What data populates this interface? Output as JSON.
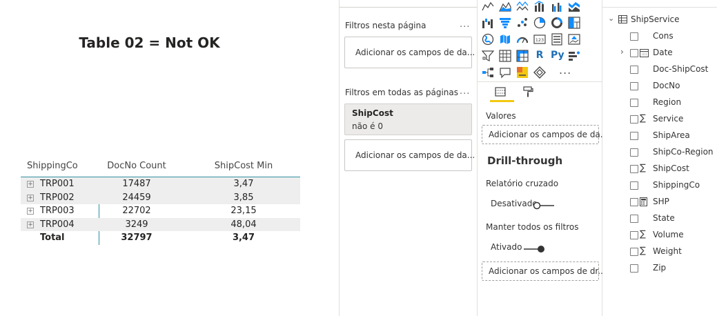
{
  "report": {
    "title": "Table 02 = Not OK",
    "matrix": {
      "headers": [
        "ShippingCo",
        "DocNo Count",
        "ShipCost Min"
      ],
      "rows": [
        {
          "co": "TRP001",
          "count": "17487",
          "min": "3,47"
        },
        {
          "co": "TRP002",
          "count": "24459",
          "min": "3,85"
        },
        {
          "co": "TRP003",
          "count": "22702",
          "min": "23,15"
        },
        {
          "co": "TRP004",
          "count": "3249",
          "min": "48,04"
        }
      ],
      "total": {
        "label": "Total",
        "count": "32797",
        "min": "3,47"
      }
    }
  },
  "filters": {
    "page_section": "Filtros nesta página",
    "page_well": "Adicionar os campos de da...",
    "all_section": "Filtros em todas as páginas",
    "card": {
      "title": "ShipCost",
      "state": "não é 0"
    },
    "all_well": "Adicionar os campos de da...",
    "more": "..."
  },
  "visualizations": {
    "icons": [
      "line-chart-icon",
      "area-chart-icon",
      "line-area-icon",
      "stacked-column-line-icon",
      "clustered-column-line-icon",
      "ribbon-chart-icon",
      "waterfall-chart-icon",
      "funnel-chart-icon",
      "scatter-chart-icon",
      "pie-chart-icon",
      "donut-chart-icon",
      "treemap-icon",
      "map-icon",
      "filled-map-icon",
      "gauge-icon",
      "card-icon",
      "multi-row-card-icon",
      "kpi-icon",
      "slicer-icon",
      "table-icon",
      "matrix-icon",
      "r-visual-icon",
      "python-visual-icon",
      "key-influencers-icon",
      "decomposition-tree-icon",
      "qa-visual-icon",
      "smart-narrative-icon",
      "power-apps-icon"
    ],
    "r_glyph": "R",
    "py_glyph": "Py",
    "more": "...",
    "values_label": "Valores",
    "values_well": "Adicionar os campos de da...",
    "drill_title": "Drill-through",
    "cross_report_label": "Relatório cruzado",
    "cross_report_state": "Desativado",
    "keep_filters_label": "Manter todos os filtros",
    "keep_filters_state": "Ativado",
    "drill_well": "Adicionar os campos de dr...",
    "accent": "#f2c811"
  },
  "fields": {
    "table": "ShipService",
    "items": [
      {
        "name": "Cons",
        "type": ""
      },
      {
        "name": "Date",
        "type": "calendar",
        "expand": true
      },
      {
        "name": "Doc-ShipCost",
        "type": ""
      },
      {
        "name": "DocNo",
        "type": ""
      },
      {
        "name": "Region",
        "type": ""
      },
      {
        "name": "Service",
        "type": "sum"
      },
      {
        "name": "ShipArea",
        "type": ""
      },
      {
        "name": "ShipCo-Region",
        "type": ""
      },
      {
        "name": "ShipCost",
        "type": "sum"
      },
      {
        "name": "ShippingCo",
        "type": ""
      },
      {
        "name": "SHP",
        "type": "calculator"
      },
      {
        "name": "State",
        "type": ""
      },
      {
        "name": "Volume",
        "type": "sum"
      },
      {
        "name": "Weight",
        "type": "sum"
      },
      {
        "name": "Zip",
        "type": ""
      }
    ],
    "sum_glyph": "∑"
  }
}
